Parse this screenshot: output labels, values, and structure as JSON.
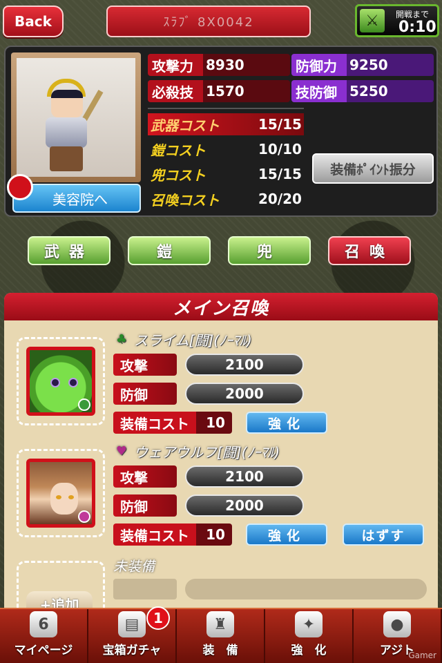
{
  "topbar": {
    "back_label": "Back",
    "player_name": "ｽﾗﾌﾞ 8X0042",
    "timer_label": "開戦まで",
    "timer_value": "0:10"
  },
  "status": {
    "attack_label": "攻撃力",
    "attack_value": "8930",
    "defense_label": "防御力",
    "defense_value": "9250",
    "special_label": "必殺技",
    "special_value": "1570",
    "skill_def_label": "技防御",
    "skill_def_value": "5250",
    "costs": [
      {
        "label": "武器コスト",
        "value": "15/15"
      },
      {
        "label": "鎧コスト",
        "value": "10/10"
      },
      {
        "label": "兜コスト",
        "value": "15/15"
      },
      {
        "label": "召喚コスト",
        "value": "20/20"
      }
    ],
    "salon_button": "美容院へ",
    "allocate_button": "装備ﾎﾟｲﾝﾄ振分"
  },
  "categories": [
    {
      "label": "武器",
      "active": false
    },
    {
      "label": "鎧",
      "active": false
    },
    {
      "label": "兜",
      "active": false
    },
    {
      "label": "召喚",
      "active": true
    }
  ],
  "summon": {
    "header": "メイン召喚",
    "entries": [
      {
        "name": "スライム[闘](ﾉｰﾏﾙ)",
        "attack_label": "攻撃",
        "attack": "2100",
        "defense_label": "防御",
        "defense": "2000",
        "cost_label": "装備コスト",
        "cost": "10",
        "enhance_button": "強化"
      },
      {
        "name": "ウェアウルフ[闘](ﾉｰﾏﾙ)",
        "attack_label": "攻撃",
        "attack": "2100",
        "defense_label": "防御",
        "defense": "2000",
        "cost_label": "装備コスト",
        "cost": "10",
        "enhance_button": "強化",
        "remove_button": "はずす"
      }
    ],
    "unequipped_label": "未装備",
    "add_button": "+追加"
  },
  "bottom_nav": [
    {
      "label": "マイページ",
      "icon": "mypage-shield-icon"
    },
    {
      "label": "宝箱ガチャ",
      "icon": "treasure-chest-icon",
      "badge": "1"
    },
    {
      "label": "装　備",
      "icon": "armor-icon"
    },
    {
      "label": "強　化",
      "icon": "enhance-swords-icon"
    },
    {
      "label": "アジト",
      "icon": "speech-bubble-icon"
    }
  ],
  "watermark": "Gamer"
}
